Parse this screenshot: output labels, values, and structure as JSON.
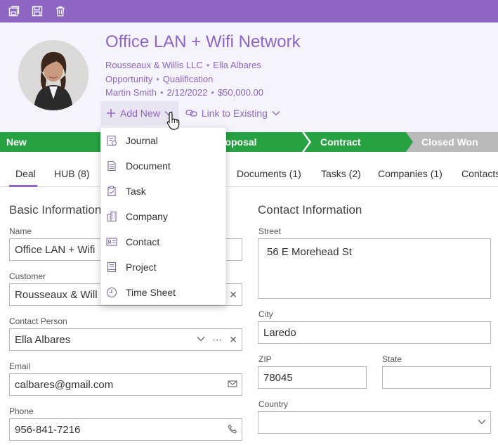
{
  "toolbar": {
    "icons": [
      "save-as-icon",
      "save-icon",
      "delete-icon"
    ]
  },
  "header": {
    "title": "Office LAN + Wifi Network",
    "company": "Rousseaux & Willis LLC",
    "contact": "Ella Albares",
    "record_type": "Opportunity",
    "stage": "Qualification",
    "owner": "Martin Smith",
    "date": "2/12/2022",
    "amount": "$50,000.00",
    "add_new_label": "Add New",
    "link_existing_label": "Link to Existing",
    "separator": "•"
  },
  "stages": {
    "items": [
      "New",
      "Proposal",
      "Contract",
      "Closed Won"
    ],
    "visible_proposal_fragment": "roposal",
    "colors": {
      "active": "#27a243",
      "inactive": "#b9b9b9"
    }
  },
  "tabs": {
    "items": [
      "Deal",
      "HUB (8)",
      "Documents (1)",
      "Tasks (2)",
      "Companies (1)",
      "Contacts"
    ]
  },
  "dropdown": {
    "items": [
      {
        "label": "Journal",
        "icon": "journal-icon"
      },
      {
        "label": "Document",
        "icon": "document-icon"
      },
      {
        "label": "Task",
        "icon": "task-icon"
      },
      {
        "label": "Company",
        "icon": "company-icon"
      },
      {
        "label": "Contact",
        "icon": "contact-card-icon"
      },
      {
        "label": "Project",
        "icon": "project-icon"
      },
      {
        "label": "Time Sheet",
        "icon": "clock-icon"
      }
    ]
  },
  "basic": {
    "title": "Basic Information",
    "name_label": "Name",
    "name_value": "Office LAN + Wifi",
    "customer_label": "Customer",
    "customer_value": "Rousseaux & Will",
    "contact_person_label": "Contact Person",
    "contact_person_value": "Ella Albares",
    "email_label": "Email",
    "email_value": "calbares@gmail.com",
    "phone_label": "Phone",
    "phone_value": "956-841-7216"
  },
  "contact_info": {
    "title": "Contact Information",
    "street_label": "Street",
    "street_value": "56 E Morehead St",
    "city_label": "City",
    "city_value": "Laredo",
    "zip_label": "ZIP",
    "zip_value": "78045",
    "state_label": "State",
    "state_value": "",
    "country_label": "Country",
    "country_value": ""
  },
  "colors": {
    "accent": "#8c65c5",
    "header_bg": "#f5f3fb",
    "stage_green": "#27a243",
    "stage_grey": "#b9b9b9"
  }
}
